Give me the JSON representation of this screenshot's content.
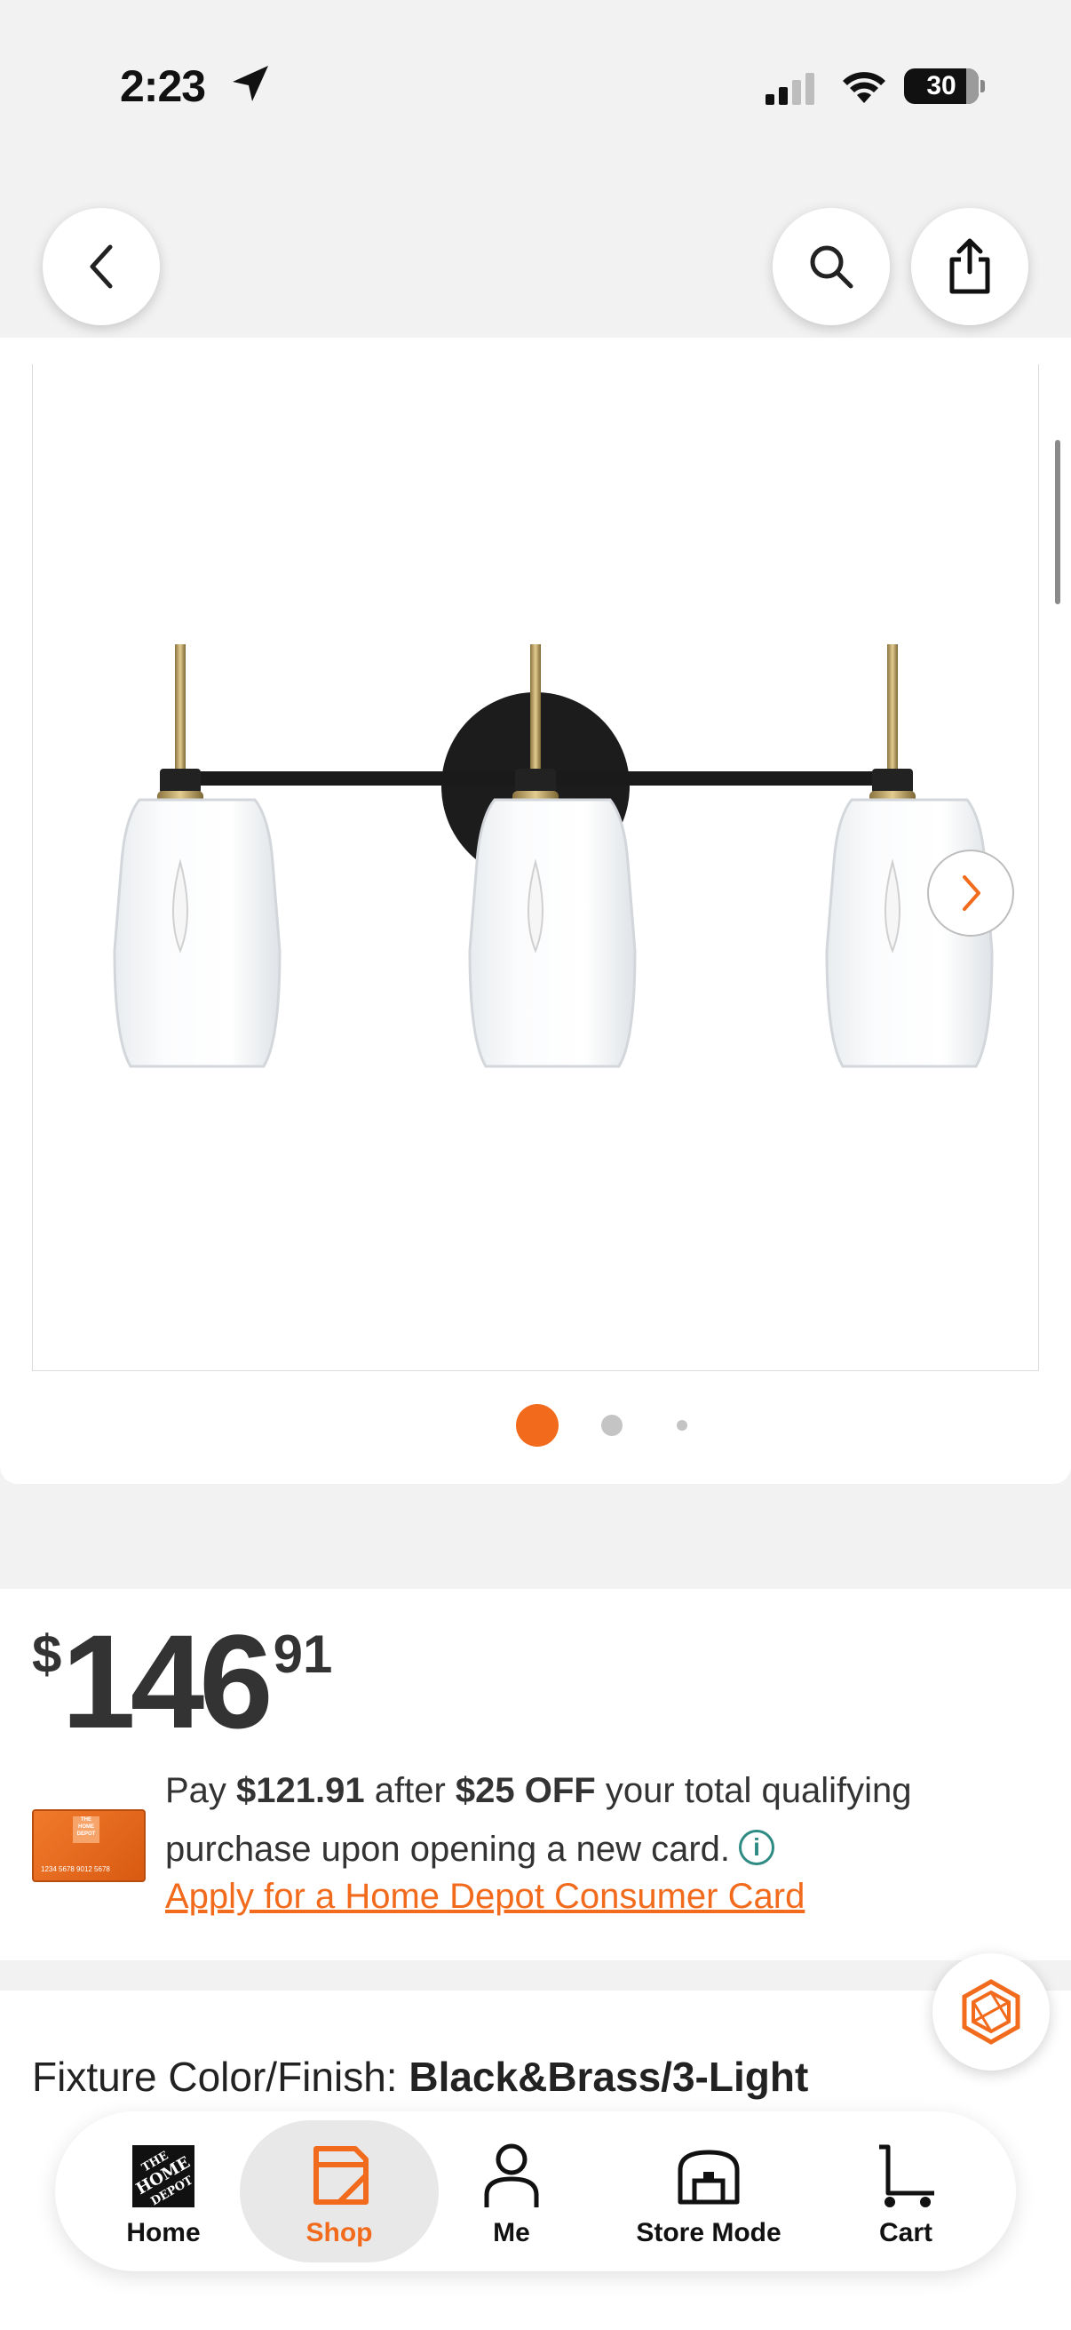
{
  "status_bar": {
    "time": "2:23",
    "battery": "30"
  },
  "header": {
    "back_icon": "chevron-left-icon",
    "search_icon": "search-icon",
    "share_icon": "share-icon"
  },
  "gallery": {
    "active_index": 0,
    "total_images": 3,
    "next_icon": "chevron-right-icon"
  },
  "price": {
    "currency": "$",
    "dollars": "146",
    "cents": "91"
  },
  "offer": {
    "text_1": "Pay ",
    "amount": "$121.91",
    "text_2": " after ",
    "discount": "$25 OFF",
    "text_3": " your total qualifying purchase upon opening a new card.",
    "info_icon": "i",
    "apply_link": "Apply for a Home Depot Consumer Card",
    "card_logo_text": "THE HOME DEPOT",
    "card_number": "1234 5678 9012 5678"
  },
  "fixture": {
    "label": "Fixture Color/Finish: ",
    "value": "Black&Brass/3-Light"
  },
  "bottom_nav": {
    "items": [
      {
        "label": "Home",
        "icon": "home-depot-logo-icon",
        "active": false
      },
      {
        "label": "Shop",
        "icon": "shop-tag-icon",
        "active": true
      },
      {
        "label": "Me",
        "icon": "person-icon",
        "active": false
      },
      {
        "label": "Store Mode",
        "icon": "store-icon",
        "active": false
      },
      {
        "label": "Cart",
        "icon": "cart-icon",
        "active": false
      }
    ]
  },
  "colors": {
    "accent": "#f26b1d",
    "info": "#2e8b84",
    "text": "#333333"
  }
}
